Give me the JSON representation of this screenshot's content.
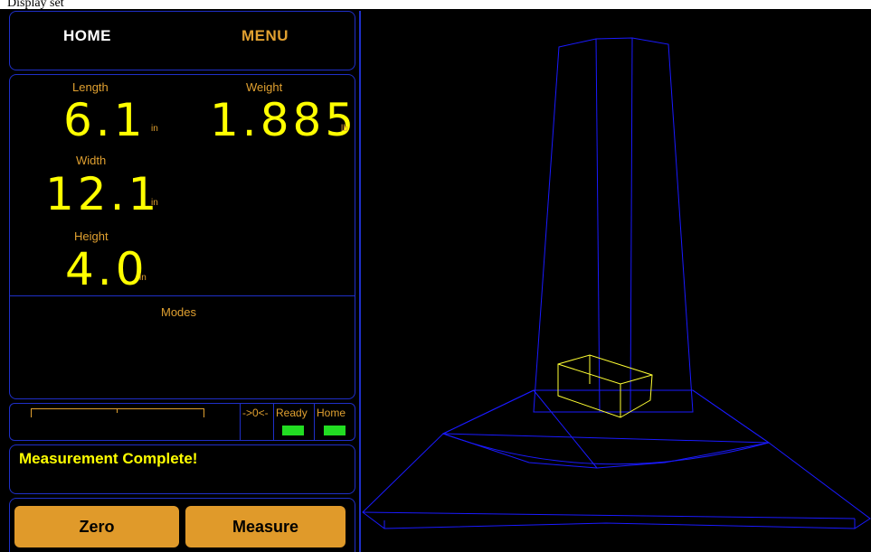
{
  "caption": "Display set",
  "nav": {
    "home_label": "HOME",
    "menu_label": "MENU"
  },
  "measurements": {
    "length": {
      "label": "Length",
      "value": "6.1",
      "unit": "in"
    },
    "weight": {
      "label": "Weight",
      "value": "1.885",
      "unit": "lb"
    },
    "width": {
      "label": "Width",
      "value": "12.1",
      "unit": "in"
    },
    "height": {
      "label": "Height",
      "value": "4.0",
      "unit": "in"
    }
  },
  "modes": {
    "label": "Modes"
  },
  "status": {
    "zero_label": "->0<-",
    "ready_label": "Ready",
    "home_label": "Home",
    "ready_color": "#22dd22",
    "home_color": "#22dd22"
  },
  "message": "Measurement Complete!",
  "actions": {
    "zero_label": "Zero",
    "measure_label": "Measure"
  },
  "colors": {
    "border": "#1f2fc8",
    "value": "#ffff00",
    "label": "#e0a030",
    "button": "#e09a2a",
    "wireframe": "#1a1aff",
    "box_outline": "#ffff33"
  }
}
